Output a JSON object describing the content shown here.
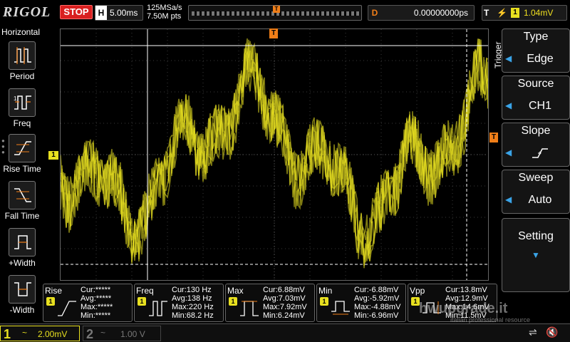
{
  "topbar": {
    "brand": "RIGOL",
    "run_state": "STOP",
    "timebase_key": "H",
    "timebase": "5.00ms",
    "sample_rate": "125MSa/s",
    "mem_depth": "7.50M pts",
    "trigger_marker": "T",
    "delay_key": "D",
    "delay": "0.00000000ps",
    "trig_key": "T",
    "trig_edge": "⚡",
    "trig_source": "1",
    "trig_level": "1.04mV"
  },
  "leftmenu": {
    "title": "Horizontal",
    "items": [
      {
        "label": "Period",
        "icon": "period-icon"
      },
      {
        "label": "Freq",
        "icon": "freq-icon"
      },
      {
        "label": "Rise Time",
        "icon": "rise-time-icon"
      },
      {
        "label": "Fall Time",
        "icon": "fall-time-icon"
      },
      {
        "label": "+Width",
        "icon": "pos-width-icon"
      },
      {
        "label": "-Width",
        "icon": "neg-width-icon"
      }
    ]
  },
  "display": {
    "ch1_marker": "1",
    "trigger_marker": "T",
    "trigger_level_marker": "T",
    "trigger_side_label": "Trigger",
    "waveform_color": "#e8e020"
  },
  "rightmenu": {
    "type": {
      "title": "Type",
      "value": "Edge"
    },
    "source": {
      "title": "Source",
      "value": "CH1"
    },
    "slope": {
      "title": "Slope",
      "value": "rising-edge-icon"
    },
    "sweep": {
      "title": "Sweep",
      "value": "Auto"
    },
    "setting": {
      "title": "Setting"
    }
  },
  "measurements": [
    {
      "name": "Rise",
      "ch": "1",
      "cur": "Cur:*****",
      "avg": "Avg:*****",
      "max": "Max:*****",
      "min": "Min:*****"
    },
    {
      "name": "Freq",
      "ch": "1",
      "cur": "Cur:130 Hz",
      "avg": "Avg:138 Hz",
      "max": "Max:220 Hz",
      "min": "Min:68.2 Hz"
    },
    {
      "name": "Max",
      "ch": "1",
      "cur": "Cur:6.88mV",
      "avg": "Avg:7.03mV",
      "max": "Max:7.92mV",
      "min": "Min:6.24mV"
    },
    {
      "name": "Min",
      "ch": "1",
      "cur": "Cur:-6.88mV",
      "avg": "Avg:-5.92mV",
      "max": "Max:-4.88mV",
      "min": "Min:-6.96mV"
    },
    {
      "name": "Vpp",
      "ch": "1",
      "cur": "Cur:13.8mV",
      "avg": "Avg:12.9mV",
      "max": "Max:14.6mV",
      "min": "Min:11.5mV"
    }
  ],
  "bottombar": {
    "ch1": {
      "num": "1",
      "coupling": "~",
      "scale": "2.00mV"
    },
    "ch2": {
      "num": "2",
      "coupling": "~",
      "scale": "1.00 V"
    }
  },
  "watermark": {
    "main": "hwupgrade.it",
    "sub": "italian professional resource"
  },
  "colors": {
    "accent": "#f07e18",
    "ch1": "#e8e020",
    "highlight": "#3aa4e8",
    "stop": "#d91f1f"
  }
}
